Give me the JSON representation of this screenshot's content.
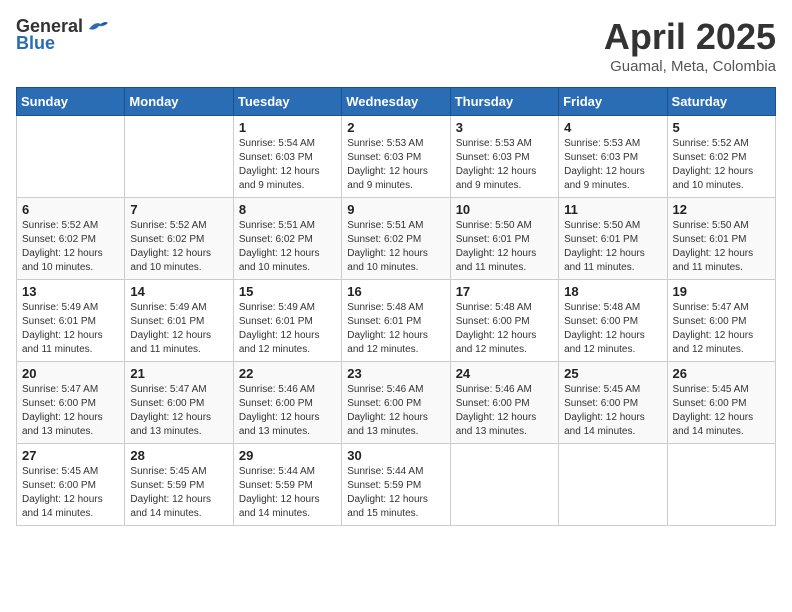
{
  "header": {
    "logo_general": "General",
    "logo_blue": "Blue",
    "month_year": "April 2025",
    "location": "Guamal, Meta, Colombia"
  },
  "days_of_week": [
    "Sunday",
    "Monday",
    "Tuesday",
    "Wednesday",
    "Thursday",
    "Friday",
    "Saturday"
  ],
  "weeks": [
    [
      {
        "day": "",
        "info": ""
      },
      {
        "day": "",
        "info": ""
      },
      {
        "day": "1",
        "info": "Sunrise: 5:54 AM\nSunset: 6:03 PM\nDaylight: 12 hours and 9 minutes."
      },
      {
        "day": "2",
        "info": "Sunrise: 5:53 AM\nSunset: 6:03 PM\nDaylight: 12 hours and 9 minutes."
      },
      {
        "day": "3",
        "info": "Sunrise: 5:53 AM\nSunset: 6:03 PM\nDaylight: 12 hours and 9 minutes."
      },
      {
        "day": "4",
        "info": "Sunrise: 5:53 AM\nSunset: 6:03 PM\nDaylight: 12 hours and 9 minutes."
      },
      {
        "day": "5",
        "info": "Sunrise: 5:52 AM\nSunset: 6:02 PM\nDaylight: 12 hours and 10 minutes."
      }
    ],
    [
      {
        "day": "6",
        "info": "Sunrise: 5:52 AM\nSunset: 6:02 PM\nDaylight: 12 hours and 10 minutes."
      },
      {
        "day": "7",
        "info": "Sunrise: 5:52 AM\nSunset: 6:02 PM\nDaylight: 12 hours and 10 minutes."
      },
      {
        "day": "8",
        "info": "Sunrise: 5:51 AM\nSunset: 6:02 PM\nDaylight: 12 hours and 10 minutes."
      },
      {
        "day": "9",
        "info": "Sunrise: 5:51 AM\nSunset: 6:02 PM\nDaylight: 12 hours and 10 minutes."
      },
      {
        "day": "10",
        "info": "Sunrise: 5:50 AM\nSunset: 6:01 PM\nDaylight: 12 hours and 11 minutes."
      },
      {
        "day": "11",
        "info": "Sunrise: 5:50 AM\nSunset: 6:01 PM\nDaylight: 12 hours and 11 minutes."
      },
      {
        "day": "12",
        "info": "Sunrise: 5:50 AM\nSunset: 6:01 PM\nDaylight: 12 hours and 11 minutes."
      }
    ],
    [
      {
        "day": "13",
        "info": "Sunrise: 5:49 AM\nSunset: 6:01 PM\nDaylight: 12 hours and 11 minutes."
      },
      {
        "day": "14",
        "info": "Sunrise: 5:49 AM\nSunset: 6:01 PM\nDaylight: 12 hours and 11 minutes."
      },
      {
        "day": "15",
        "info": "Sunrise: 5:49 AM\nSunset: 6:01 PM\nDaylight: 12 hours and 12 minutes."
      },
      {
        "day": "16",
        "info": "Sunrise: 5:48 AM\nSunset: 6:01 PM\nDaylight: 12 hours and 12 minutes."
      },
      {
        "day": "17",
        "info": "Sunrise: 5:48 AM\nSunset: 6:00 PM\nDaylight: 12 hours and 12 minutes."
      },
      {
        "day": "18",
        "info": "Sunrise: 5:48 AM\nSunset: 6:00 PM\nDaylight: 12 hours and 12 minutes."
      },
      {
        "day": "19",
        "info": "Sunrise: 5:47 AM\nSunset: 6:00 PM\nDaylight: 12 hours and 12 minutes."
      }
    ],
    [
      {
        "day": "20",
        "info": "Sunrise: 5:47 AM\nSunset: 6:00 PM\nDaylight: 12 hours and 13 minutes."
      },
      {
        "day": "21",
        "info": "Sunrise: 5:47 AM\nSunset: 6:00 PM\nDaylight: 12 hours and 13 minutes."
      },
      {
        "day": "22",
        "info": "Sunrise: 5:46 AM\nSunset: 6:00 PM\nDaylight: 12 hours and 13 minutes."
      },
      {
        "day": "23",
        "info": "Sunrise: 5:46 AM\nSunset: 6:00 PM\nDaylight: 12 hours and 13 minutes."
      },
      {
        "day": "24",
        "info": "Sunrise: 5:46 AM\nSunset: 6:00 PM\nDaylight: 12 hours and 13 minutes."
      },
      {
        "day": "25",
        "info": "Sunrise: 5:45 AM\nSunset: 6:00 PM\nDaylight: 12 hours and 14 minutes."
      },
      {
        "day": "26",
        "info": "Sunrise: 5:45 AM\nSunset: 6:00 PM\nDaylight: 12 hours and 14 minutes."
      }
    ],
    [
      {
        "day": "27",
        "info": "Sunrise: 5:45 AM\nSunset: 6:00 PM\nDaylight: 12 hours and 14 minutes."
      },
      {
        "day": "28",
        "info": "Sunrise: 5:45 AM\nSunset: 5:59 PM\nDaylight: 12 hours and 14 minutes."
      },
      {
        "day": "29",
        "info": "Sunrise: 5:44 AM\nSunset: 5:59 PM\nDaylight: 12 hours and 14 minutes."
      },
      {
        "day": "30",
        "info": "Sunrise: 5:44 AM\nSunset: 5:59 PM\nDaylight: 12 hours and 15 minutes."
      },
      {
        "day": "",
        "info": ""
      },
      {
        "day": "",
        "info": ""
      },
      {
        "day": "",
        "info": ""
      }
    ]
  ]
}
